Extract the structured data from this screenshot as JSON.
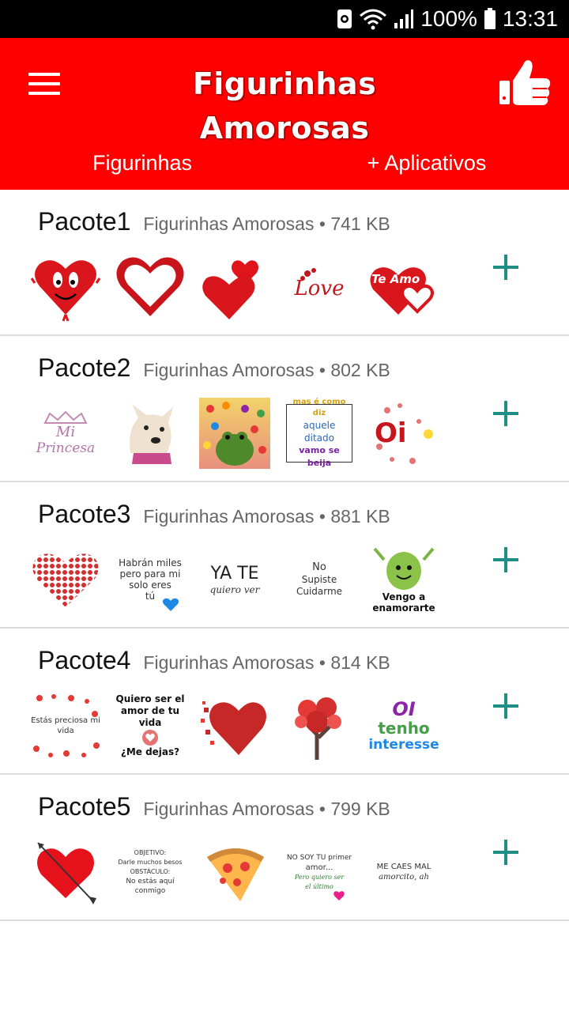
{
  "status_bar": {
    "battery": "100%",
    "time": "13:31"
  },
  "app_bar": {
    "title": "Figurinhas Amorosas",
    "tabs": [
      {
        "label": "Figurinhas"
      },
      {
        "label": "+ Aplicativos"
      }
    ]
  },
  "packs": [
    {
      "name": "Pacote1",
      "publisher": "Figurinhas Amorosas",
      "size": "741 KB",
      "stickers": [
        {
          "icon": "smiling-heart-sticker"
        },
        {
          "icon": "outline-heart-sticker"
        },
        {
          "icon": "two-hearts-sticker"
        },
        {
          "icon": "love-script-sticker",
          "text": "Love"
        },
        {
          "icon": "te-amo-hearts-sticker",
          "text": "Te Amo"
        }
      ]
    },
    {
      "name": "Pacote2",
      "publisher": "Figurinhas Amorosas",
      "size": "802 KB",
      "stickers": [
        {
          "icon": "mi-princesa-sticker",
          "text_top": "Mi",
          "text_bottom": "Princesa"
        },
        {
          "icon": "dog-photo-sticker"
        },
        {
          "icon": "frog-hearts-sticker"
        },
        {
          "icon": "ditado-text-sticker",
          "line1": "mas é como diz",
          "line2": "aquele ditado",
          "line3": "vamo se beija"
        },
        {
          "icon": "oi-hearts-sticker",
          "text": "Oi"
        }
      ]
    },
    {
      "name": "Pacote3",
      "publisher": "Figurinhas Amorosas",
      "size": "881 KB",
      "stickers": [
        {
          "icon": "mosaic-heart-sticker"
        },
        {
          "icon": "habran-miles-sticker",
          "line1": "Habrán miles",
          "line2": "pero para mi",
          "line3": "solo eres",
          "line4": "tú"
        },
        {
          "icon": "ya-te-quiero-ver-sticker",
          "line1": "YA TE",
          "line2": "quiero ver"
        },
        {
          "icon": "no-supiste-cuidarme-sticker",
          "line1": "No",
          "line2": "Supiste",
          "line3": "Cuidarme"
        },
        {
          "icon": "apple-character-sticker",
          "line1": "Vengo a",
          "line2": "enamorarte"
        }
      ]
    },
    {
      "name": "Pacote4",
      "publisher": "Figurinhas Amorosas",
      "size": "814 KB",
      "stickers": [
        {
          "icon": "estas-preciosa-sticker",
          "line1": "Estás preciosa mi",
          "line2": "vida"
        },
        {
          "icon": "quiero-ser-el-amor-sticker",
          "line1": "Quiero ser el",
          "line2": "amor de tu vida",
          "line3": "¿Me dejas?"
        },
        {
          "icon": "shattered-heart-sticker"
        },
        {
          "icon": "heart-tree-sticker"
        },
        {
          "icon": "oi-tenho-interesse-sticker",
          "line1": "OI",
          "line2": "tenho",
          "line3": "interesse"
        }
      ]
    },
    {
      "name": "Pacote5",
      "publisher": "Figurinhas Amorosas",
      "size": "799 KB",
      "stickers": [
        {
          "icon": "arrow-heart-sticker"
        },
        {
          "icon": "obstaculo-text-sticker",
          "line1": "OBJETIVO:",
          "line2": "Darle muchos besos",
          "line3": "OBSTÁCULO:",
          "line4": "No estás aquí",
          "line5": "conmigo"
        },
        {
          "icon": "pizza-heart-sticker"
        },
        {
          "icon": "primer-amor-sticker",
          "line1": "NO SOY TU primer",
          "line2": "amor...",
          "line3": "Pero quiero ser",
          "line4": "el último"
        },
        {
          "icon": "me-caes-mal-sticker",
          "line1": "ME CAES MAL",
          "line2": "amorcito, ah"
        }
      ]
    }
  ]
}
